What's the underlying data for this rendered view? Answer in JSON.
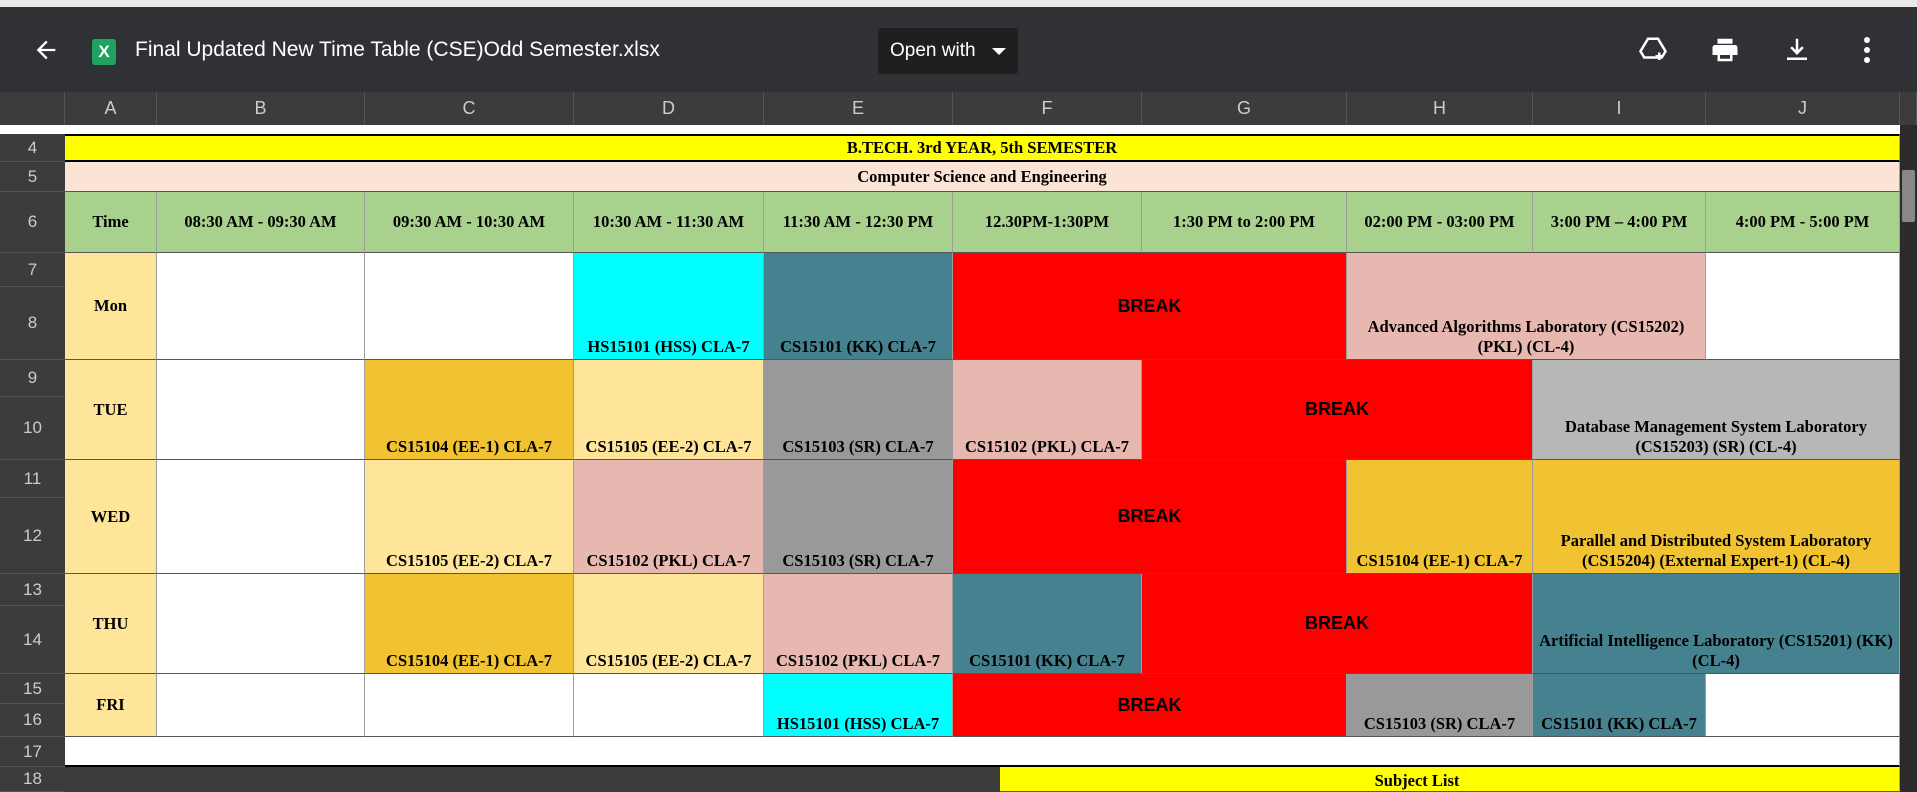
{
  "topbar": {
    "file_name": "Final Updated New Time Table (CSE)Odd Semester.xlsx",
    "file_badge": "X",
    "open_with_label": "Open with",
    "icons": [
      "back-arrow-icon",
      "add-to-drive-icon",
      "print-icon",
      "download-icon",
      "more-vert-icon"
    ]
  },
  "columns": [
    "A",
    "B",
    "C",
    "D",
    "E",
    "F",
    "G",
    "H",
    "I",
    "J"
  ],
  "rows": [
    "4",
    "5",
    "6",
    "7",
    "8",
    "9",
    "10",
    "11",
    "12",
    "13",
    "14",
    "15",
    "16",
    "17",
    "18"
  ],
  "banner": {
    "year": "B.TECH. 3rd YEAR, 5th  SEMESTER",
    "dept": "Computer Science and Engineering"
  },
  "header": {
    "time": "Time",
    "slots": [
      "08:30 AM - 09:30 AM",
      "09:30 AM - 10:30 AM",
      "10:30 AM - 11:30 AM",
      "11:30 AM - 12:30 PM",
      "12.30PM-1:30PM",
      "1:30 PM to 2:00 PM",
      "02:00 PM - 03:00 PM",
      "3:00 PM – 4:00 PM",
      "4:00 PM - 5:00 PM"
    ]
  },
  "days": {
    "mon": "Mon",
    "tue": "TUE",
    "wed": "WED",
    "thu": "THU",
    "fri": "FRI"
  },
  "schedule": {
    "mon_d": "HS15101 (HSS) CLA-7",
    "mon_e": "CS15101 (KK) CLA-7",
    "mon_break": "BREAK",
    "mon_hi": "Advanced Algorithms Laboratory (CS15202) (PKL) (CL-4)",
    "tue_c": "CS15104 (EE-1) CLA-7",
    "tue_d": "CS15105 (EE-2) CLA-7",
    "tue_e": "CS15103 (SR) CLA-7",
    "tue_f": "CS15102 (PKL) CLA-7",
    "tue_break": "BREAK",
    "tue_ij": "Database Management System Laboratory (CS15203) (SR) (CL-4)",
    "wed_c": "CS15105 (EE-2) CLA-7",
    "wed_d": "CS15102 (PKL) CLA-7",
    "wed_e": "CS15103 (SR) CLA-7",
    "wed_break": "BREAK",
    "wed_h": "CS15104 (EE-1) CLA-7",
    "wed_ij": "Parallel and Distributed System Laboratory (CS15204) (External Expert-1) (CL-4)",
    "thu_c": "CS15104 (EE-1) CLA-7",
    "thu_d": "CS15105 (EE-2) CLA-7",
    "thu_e": "CS15102 (PKL) CLA-7",
    "thu_f": "CS15101 (KK) CLA-7",
    "thu_break": "BREAK",
    "thu_ij": "Artificial Intelligence Laboratory (CS15201) (KK) (CL-4)",
    "fri_e": "HS15101 (HSS) CLA-7",
    "fri_break": "BREAK",
    "fri_h": "CS15103 (SR) CLA-7",
    "fri_i": "CS15101 (KK) CLA-7"
  },
  "subject_list_label": "Subject List",
  "colors": {
    "yellow": "#ffff00",
    "peach": "#fbe4d5",
    "green_header": "#a9d18e",
    "day_bg": "#ffe599",
    "cyan": "#00ffff",
    "teal": "#45818e",
    "red": "#ff0000",
    "pink": "#e6b8af",
    "gold": "#f1c232",
    "light_gold": "#ffe599",
    "gray": "#999999",
    "light_gray": "#b7b7b7"
  }
}
